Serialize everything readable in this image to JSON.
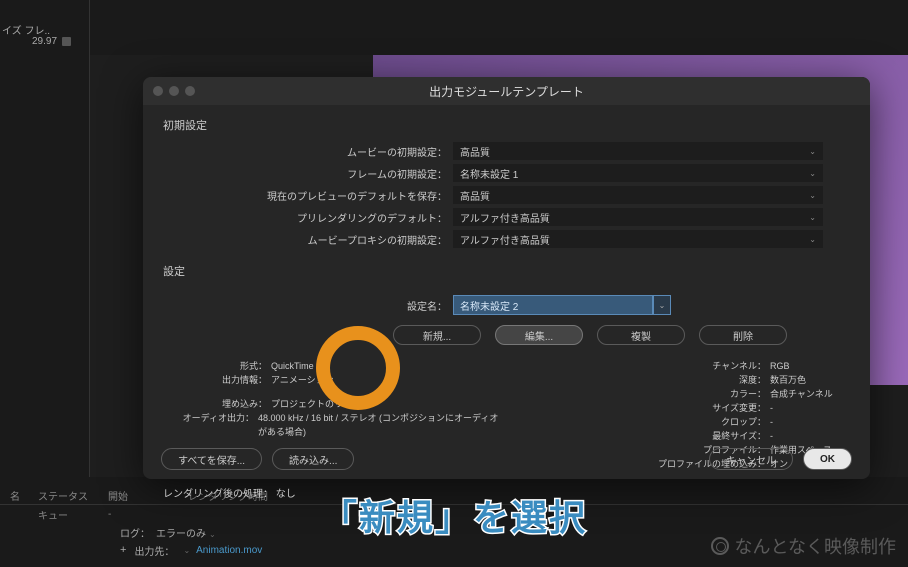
{
  "top": {
    "tab": "イズ フレ..",
    "fps": "29.97"
  },
  "dialog": {
    "title": "出力モジュールテンプレート",
    "section_defaults": "初期設定",
    "defaults": {
      "movie_default_label": "ムービーの初期設定：",
      "movie_default_value": "高品質",
      "frame_default_label": "フレームの初期設定：",
      "frame_default_value": "名称未設定 1",
      "preview_save_label": "現在のプレビューのデフォルトを保存：",
      "preview_save_value": "高品質",
      "prerender_label": "プリレンダリングのデフォルト：",
      "prerender_value": "アルファ付き高品質",
      "proxy_label": "ムービープロキシの初期設定：",
      "proxy_value": "アルファ付き高品質"
    },
    "section_settings": "設定",
    "settings_name_label": "設定名：",
    "settings_name_value": "名称未設定 2",
    "buttons": {
      "new": "新規...",
      "edit": "編集...",
      "dup": "複製",
      "del": "削除"
    },
    "info_left": {
      "format_label": "形式：",
      "format_value": "QuickTime",
      "output_label": "出力情報：",
      "output_value": "アニメーション",
      "embed_label": "埋め込み：",
      "embed_value": "プロジェクトのリンク",
      "audio_label": "オーディオ出力：",
      "audio_value": "48.000 kHz / 16 bit / ステレオ (コンポジションにオーディオがある場合)"
    },
    "info_right": {
      "channel_label": "チャンネル：",
      "channel_value": "RGB",
      "depth_label": "深度：",
      "depth_value": "数百万色",
      "color_label": "カラー：",
      "color_value": "合成チャンネル",
      "resize_label": "サイズ変更：",
      "resize_value": "-",
      "crop_label": "クロップ：",
      "crop_value": "-",
      "final_label": "最終サイズ：",
      "final_value": "-",
      "profile_label": "プロファイル：",
      "profile_value": "作業用スペース",
      "embed_label": "プロファイルの埋め込み：",
      "embed_value": "オン"
    },
    "render_after_label": "レンダリング後の処理：",
    "render_after_value": "なし",
    "footer": {
      "save_all": "すべてを保存...",
      "load": "読み込み...",
      "cancel": "キャンセル",
      "ok": "OK"
    }
  },
  "queue": {
    "cols": {
      "name": "名",
      "status": "ステータス",
      "start": "開始",
      "rtime": "レンダリング時間"
    },
    "row": {
      "label": "キュー",
      "dash": "-"
    },
    "log_label": "ログ：",
    "log_value": "エラーのみ",
    "output_label": "出力先：",
    "output_value": "Animation.mov"
  },
  "caption": "「新規」を選択",
  "watermark": "なんとなく映像制作"
}
